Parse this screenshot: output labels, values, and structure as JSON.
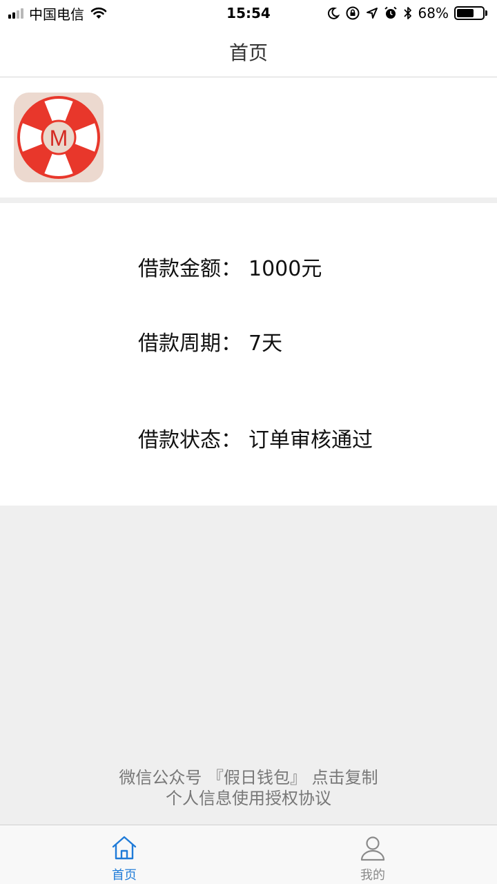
{
  "status_bar": {
    "carrier": "中国电信",
    "time": "15:54",
    "battery_percent": "68%",
    "battery_level": 0.68,
    "icons": [
      "signal-icon",
      "wifi-icon",
      "moon-icon",
      "rotation-lock-icon",
      "location-icon",
      "alarm-icon",
      "bluetooth-icon",
      "battery-icon"
    ]
  },
  "nav": {
    "title": "首页"
  },
  "logo": {
    "letter": "M",
    "icon": "lifebuoy-icon"
  },
  "loan": {
    "amount_label": "借款金额：",
    "amount_value": "1000元",
    "period_label": "借款周期：",
    "period_value": "7天",
    "status_label": "借款状态：",
    "status_value": "订单审核通过"
  },
  "footer": {
    "line1": "微信公众号 『假日钱包』 点击复制",
    "line2": "个人信息使用授权协议"
  },
  "tabs": [
    {
      "label": "首页",
      "icon": "home-icon",
      "active": true
    },
    {
      "label": "我的",
      "icon": "user-icon",
      "active": false
    }
  ],
  "colors": {
    "accent": "#1f7bd8",
    "logo_red": "#e8372b",
    "background": "#efefef"
  }
}
